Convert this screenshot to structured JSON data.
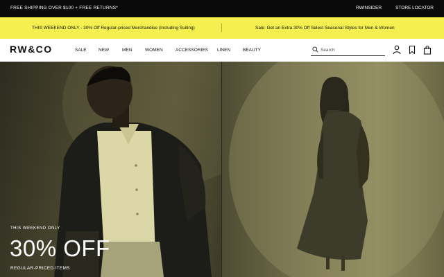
{
  "topbar": {
    "shipping": "FREE SHIPPING OVER $100 + FREE RETURNS*",
    "links": [
      "RWINSIDER",
      "STORE LOCATOR"
    ]
  },
  "promo": {
    "left": "THIS WEEKEND ONLY - 30% Off Regular-priced Merchandise (Including Suiting)",
    "right": "Sale: Get an Extra 30% Off Select Seasonal Styles for Men & Women"
  },
  "nav": {
    "logo": "RW&CO",
    "menu": [
      "SALE",
      "NEW",
      "MEN",
      "WOMEN",
      "ACCESSORIES",
      "LINEN",
      "BEAUTY"
    ],
    "search_placeholder": "Search"
  },
  "hero": {
    "eyebrow": "THIS WEEKEND ONLY",
    "headline": "30% OFF",
    "sub": "REGULAR-PRICED ITEMS"
  },
  "colors": {
    "topbar": "#0a0a0a",
    "promo": "#f5ef4f",
    "hero_tint": "#5c5838"
  },
  "icons": [
    "search-icon",
    "account-icon",
    "bookmark-icon",
    "shopping-bag-icon"
  ]
}
